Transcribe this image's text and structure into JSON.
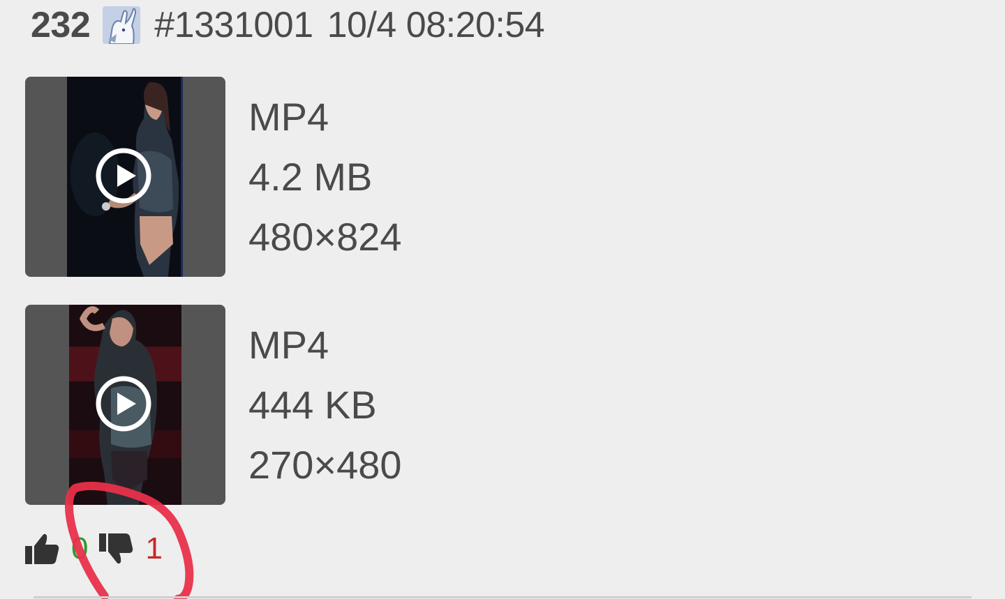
{
  "post": {
    "number": "232",
    "id": "#1331001",
    "timestamp": "10/4 08:20:54",
    "avatar_icon": "rabbit-avatar-icon"
  },
  "attachments": [
    {
      "type": "MP4",
      "size": "4.2 MB",
      "dimensions": "480×824",
      "icon": "play-icon"
    },
    {
      "type": "MP4",
      "size": "444 KB",
      "dimensions": "270×480",
      "icon": "play-icon"
    }
  ],
  "votes": {
    "up_icon": "thumbs-up-icon",
    "up_count": "0",
    "down_icon": "thumbs-down-icon",
    "down_count": "1"
  },
  "colors": {
    "background": "#eeeeee",
    "text": "#4a4a4a",
    "upvote": "#2e9a2e",
    "downvote": "#c62828",
    "annotation": "#e8304a"
  }
}
